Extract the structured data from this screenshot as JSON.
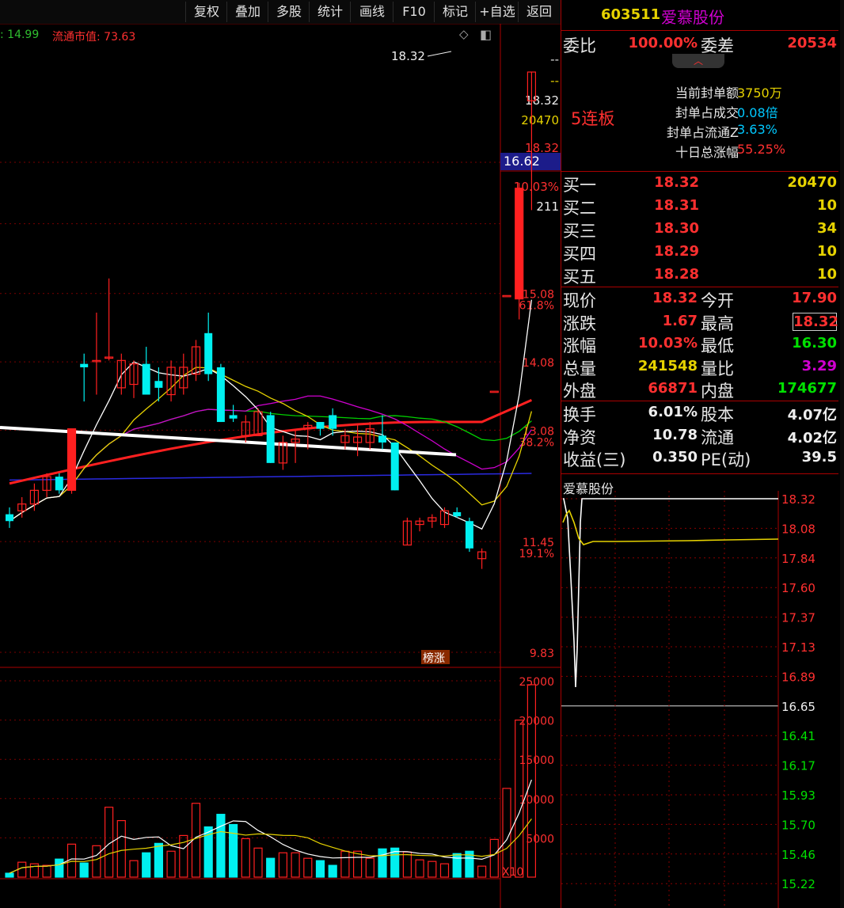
{
  "toolbar": {
    "buttons": [
      "复权",
      "叠加",
      "多股",
      "统计",
      "画线",
      "F10",
      "标记",
      "+自选",
      "返回"
    ]
  },
  "chart_header": {
    "fragment": ": 14.99",
    "float_cap_label": "流通市值: 73.63"
  },
  "chart_tools": {
    "diamond": "◇",
    "toggle": "◧"
  },
  "price_axis": {
    "labels": [
      "15.08",
      "14.08",
      "13.08",
      "11.45",
      "9.83"
    ],
    "pct_labels": [
      "61.8%",
      "38.2%",
      "19.1%"
    ],
    "top_info": [
      "--",
      "--",
      "18.32",
      "20470",
      "18.32",
      "10.03%",
      "211"
    ],
    "current_tag": "16.62"
  },
  "peak_label": "18.32",
  "limit_up_badge": "榜涨",
  "volume_axis": {
    "labels": [
      "25000",
      "20000",
      "15000",
      "10000",
      "5000"
    ],
    "unit": "X10"
  },
  "chart_data": {
    "type": "candlestick",
    "candles": [
      {
        "o": 11.85,
        "h": 11.95,
        "l": 11.65,
        "c": 11.75
      },
      {
        "o": 11.9,
        "h": 12.1,
        "l": 11.8,
        "c": 12.0
      },
      {
        "o": 12.0,
        "h": 12.3,
        "l": 11.9,
        "c": 12.2
      },
      {
        "o": 12.2,
        "h": 12.45,
        "l": 12.1,
        "c": 12.4
      },
      {
        "o": 12.4,
        "h": 12.45,
        "l": 12.15,
        "c": 12.2
      },
      {
        "o": 12.2,
        "h": 13.1,
        "l": 12.15,
        "c": 13.1
      },
      {
        "o": 14.05,
        "h": 14.2,
        "l": 13.5,
        "c": 14.0
      },
      {
        "o": 14.1,
        "h": 14.8,
        "l": 13.6,
        "c": 14.1
      },
      {
        "o": 14.15,
        "h": 15.3,
        "l": 14.1,
        "c": 14.15
      },
      {
        "o": 13.7,
        "h": 14.2,
        "l": 13.6,
        "c": 14.1
      },
      {
        "o": 13.75,
        "h": 14.1,
        "l": 13.55,
        "c": 14.05
      },
      {
        "o": 14.05,
        "h": 14.3,
        "l": 13.6,
        "c": 13.6
      },
      {
        "o": 13.8,
        "h": 14.0,
        "l": 13.5,
        "c": 13.7
      },
      {
        "o": 13.6,
        "h": 14.1,
        "l": 13.5,
        "c": 14.0
      },
      {
        "o": 13.7,
        "h": 14.2,
        "l": 13.6,
        "c": 14.0
      },
      {
        "o": 13.9,
        "h": 14.4,
        "l": 13.8,
        "c": 14.3
      },
      {
        "o": 14.5,
        "h": 14.8,
        "l": 13.8,
        "c": 13.9
      },
      {
        "o": 14.0,
        "h": 14.05,
        "l": 13.2,
        "c": 13.2
      },
      {
        "o": 13.3,
        "h": 13.45,
        "l": 13.2,
        "c": 13.25
      },
      {
        "o": 13.0,
        "h": 13.3,
        "l": 12.9,
        "c": 13.2
      },
      {
        "o": 13.0,
        "h": 13.4,
        "l": 13.0,
        "c": 13.35
      },
      {
        "o": 13.3,
        "h": 13.35,
        "l": 12.6,
        "c": 12.6
      },
      {
        "o": 12.6,
        "h": 13.0,
        "l": 12.5,
        "c": 12.9
      },
      {
        "o": 12.9,
        "h": 13.1,
        "l": 12.6,
        "c": 12.95
      },
      {
        "o": 13.1,
        "h": 13.2,
        "l": 12.8,
        "c": 13.15
      },
      {
        "o": 13.2,
        "h": 13.2,
        "l": 13.0,
        "c": 13.1
      },
      {
        "o": 13.3,
        "h": 13.4,
        "l": 13.0,
        "c": 13.1
      },
      {
        "o": 12.9,
        "h": 13.1,
        "l": 12.8,
        "c": 13.0
      },
      {
        "o": 12.9,
        "h": 13.15,
        "l": 12.7,
        "c": 12.98
      },
      {
        "o": 12.9,
        "h": 13.2,
        "l": 12.8,
        "c": 13.1
      },
      {
        "o": 13.0,
        "h": 13.3,
        "l": 12.8,
        "c": 12.9
      },
      {
        "o": 12.9,
        "h": 12.9,
        "l": 12.2,
        "c": 12.2
      },
      {
        "o": 11.4,
        "h": 11.8,
        "l": 11.4,
        "c": 11.75
      },
      {
        "o": 11.7,
        "h": 11.8,
        "l": 11.6,
        "c": 11.75
      },
      {
        "o": 11.75,
        "h": 11.85,
        "l": 11.65,
        "c": 11.8
      },
      {
        "o": 11.7,
        "h": 11.95,
        "l": 11.65,
        "c": 11.9
      },
      {
        "o": 11.88,
        "h": 11.95,
        "l": 11.8,
        "c": 11.82
      },
      {
        "o": 11.75,
        "h": 11.8,
        "l": 11.3,
        "c": 11.35
      },
      {
        "o": 11.2,
        "h": 11.35,
        "l": 11.05,
        "c": 11.3
      },
      {
        "o": 13.65,
        "h": 13.65,
        "l": 13.65,
        "c": 13.65
      },
      {
        "o": 15.05,
        "h": 15.05,
        "l": 15.05,
        "c": 15.05
      },
      {
        "o": 15.0,
        "h": 16.7,
        "l": 14.7,
        "c": 16.62
      },
      {
        "o": 17.9,
        "h": 18.32,
        "l": 16.3,
        "c": 18.32
      }
    ],
    "volumes": [
      500,
      1900,
      1700,
      1500,
      2300,
      4200,
      1800,
      4000,
      8900,
      7200,
      2100,
      3100,
      4300,
      3300,
      5300,
      9400,
      6400,
      8000,
      6700,
      4900,
      3700,
      2400,
      3100,
      3100,
      2400,
      2100,
      1500,
      3300,
      3300,
      2400,
      3600,
      3700,
      3200,
      2200,
      2000,
      1700,
      3000,
      3300,
      1400,
      4800,
      11300,
      20000,
      24500
    ],
    "overlay_lines": [
      {
        "name": "MA5",
        "color": "#ffffff"
      },
      {
        "name": "MA10",
        "color": "#e6d200"
      },
      {
        "name": "MA20",
        "color": "#d000d0"
      },
      {
        "name": "MA30",
        "color": "#00d000"
      },
      {
        "name": "MA60",
        "color": "#ff2020"
      },
      {
        "name": "MA120",
        "color": "#2a2ae0"
      },
      {
        "name": "MA250",
        "color": "#ffffff"
      }
    ],
    "ylim": [
      9.83,
      18.32
    ],
    "volume_ylim": [
      0,
      25000
    ]
  },
  "stock": {
    "code": "603511",
    "name": "爱慕股份",
    "weibi_label": "委比",
    "weibi": "100.00%",
    "weicha_label": "委差",
    "weicha": "20534",
    "lianban": "5连板",
    "seal_rows": [
      {
        "label": "当前封单额",
        "value": "3750万",
        "color": "#e6d200"
      },
      {
        "label": "封单占成交",
        "value": "0.08倍",
        "color": "#00c8ff"
      },
      {
        "label": "封单占流通Z",
        "value": "3.63%",
        "color": "#00c8ff"
      },
      {
        "label": "十日总涨幅",
        "value": "55.25%",
        "color": "#ff3030"
      }
    ],
    "bids": [
      {
        "label": "买一",
        "price": "18.32",
        "vol": "20470"
      },
      {
        "label": "买二",
        "price": "18.31",
        "vol": "10"
      },
      {
        "label": "买三",
        "price": "18.30",
        "vol": "34"
      },
      {
        "label": "买四",
        "price": "18.29",
        "vol": "10"
      },
      {
        "label": "买五",
        "price": "18.28",
        "vol": "10"
      }
    ],
    "quote": [
      {
        "l1": "现价",
        "v1": "18.32",
        "c1": "#ff3030",
        "l2": "今开",
        "v2": "17.90",
        "c2": "#ff3030"
      },
      {
        "l1": "涨跌",
        "v1": "1.67",
        "c1": "#ff3030",
        "l2": "最高",
        "v2": "18.32",
        "c2": "#ff3030"
      },
      {
        "l1": "涨幅",
        "v1": "10.03%",
        "c1": "#ff3030",
        "l2": "最低",
        "v2": "16.30",
        "c2": "#00e000"
      },
      {
        "l1": "总量",
        "v1": "241548",
        "c1": "#e6d200",
        "l2": "量比",
        "v2": "3.29",
        "c2": "#d000d0"
      },
      {
        "l1": "外盘",
        "v1": "66871",
        "c1": "#ff3030",
        "l2": "内盘",
        "v2": "174677",
        "c2": "#00e000"
      }
    ],
    "fin": [
      {
        "l1": "换手",
        "v1": "6.01%",
        "l2": "股本",
        "v2": "4.07亿"
      },
      {
        "l1": "净资",
        "v1": "10.78",
        "l2": "流通",
        "v2": "4.02亿"
      },
      {
        "l1": "收益(三)",
        "v1": "0.350",
        "l2": "PE(动)",
        "v2": "39.5"
      }
    ]
  },
  "intraday": {
    "title": "爱慕股份",
    "price_labels": [
      "18.32",
      "18.08",
      "17.84",
      "17.60",
      "17.37",
      "17.13",
      "16.89",
      "16.65",
      "16.41",
      "16.17",
      "15.93",
      "15.70",
      "15.46",
      "15.22"
    ]
  }
}
